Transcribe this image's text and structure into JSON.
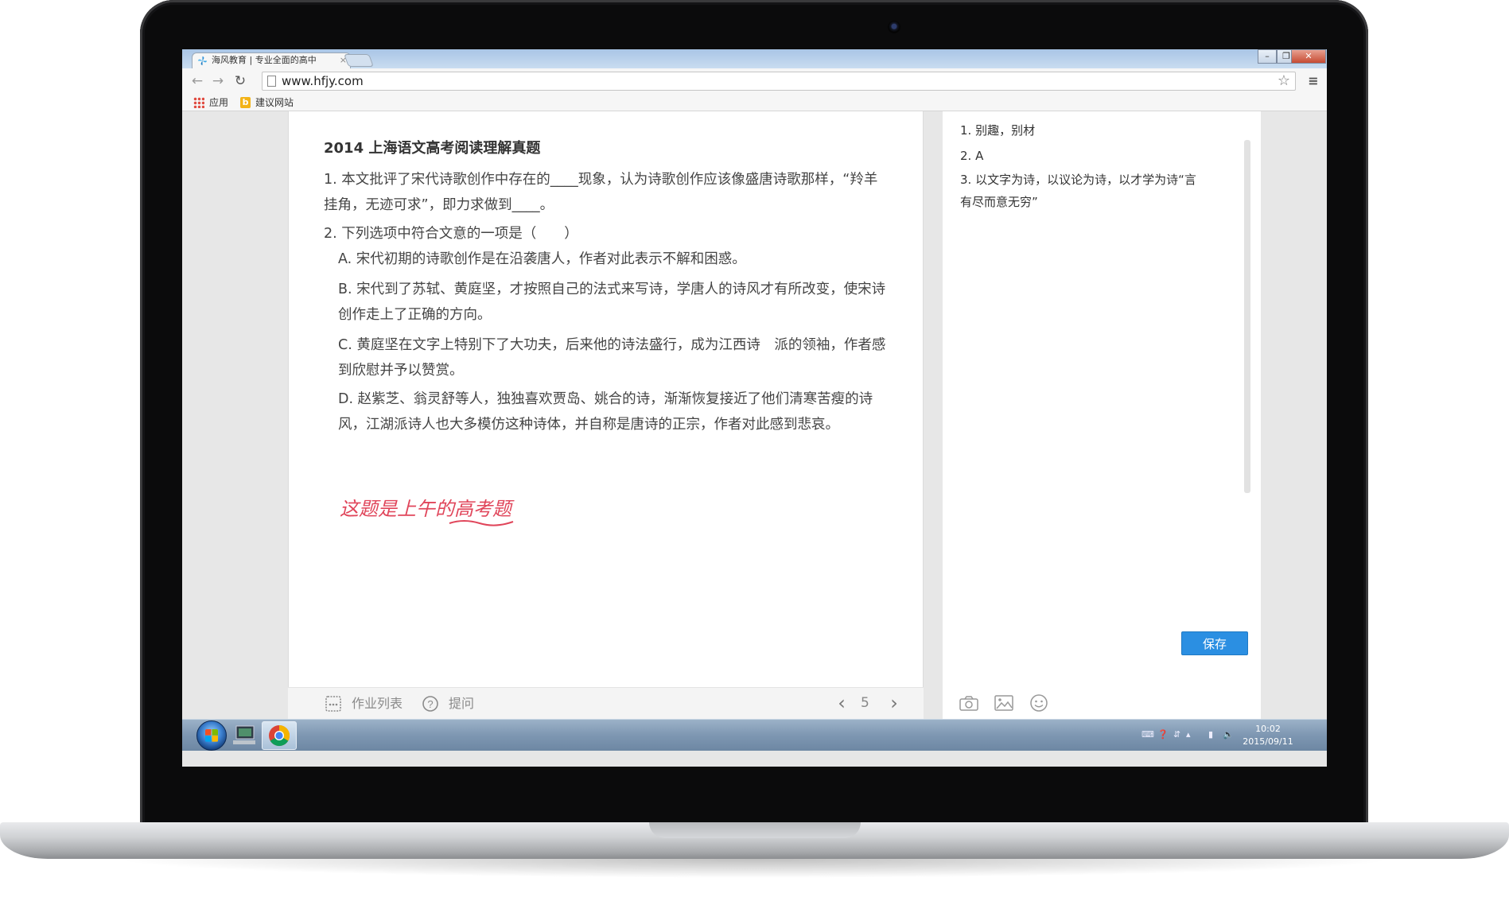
{
  "browser": {
    "tab_title": "海风教育 | 专业全面的高中",
    "url": "www.hfjy.com",
    "bookmarks": [
      {
        "label": "应用"
      },
      {
        "label": "建议网站"
      }
    ]
  },
  "question": {
    "title": "2014 上海语文高考阅读理解真题",
    "q1": "1. 本文批评了宋代诗歌创作中存在的____现象，认为诗歌创作应该像盛唐诗歌那样，“羚羊挂角，无迹可求”，即力求做到____。",
    "q2": "2. 下列选项中符合文意的一项是（　　）",
    "options": [
      "A. 宋代初期的诗歌创作是在沿袭唐人，作者对此表示不解和困惑。",
      "B. 宋代到了苏轼、黄庭坚，才按照自己的法式来写诗，学唐人的诗风才有所改变，使宋诗创作走上了正确的方向。",
      "C. 黄庭坚在文字上特别下了大功夫，后来他的诗法盛行，成为江西诗　派的领袖，作者感到欣慰并予以赞赏。",
      "D. 赵紫芝、翁灵舒等人，独独喜欢贾岛、姚合的诗，渐渐恢复接近了他们清寒苦瘦的诗风，江湖派诗人也大多模仿这种诗体，并自称是唐诗的正宗，作者对此感到悲哀。"
    ],
    "handwritten_note": "这题是上午的高考题"
  },
  "bottom_bar": {
    "homework_list_label": "作业列表",
    "ask_label": "提问",
    "page_number": "5"
  },
  "answers": {
    "items": [
      "1. 别趣，别材",
      "2. A",
      "3. 以文字为诗，以议论为诗，以才学为诗“言有尽而意无穷”"
    ],
    "save_label": "保存"
  },
  "taskbar": {
    "time": "10:02",
    "date": "2015/09/11"
  },
  "colors": {
    "accent_button": "#2b8fe2",
    "handwriting": "#e0455a"
  }
}
